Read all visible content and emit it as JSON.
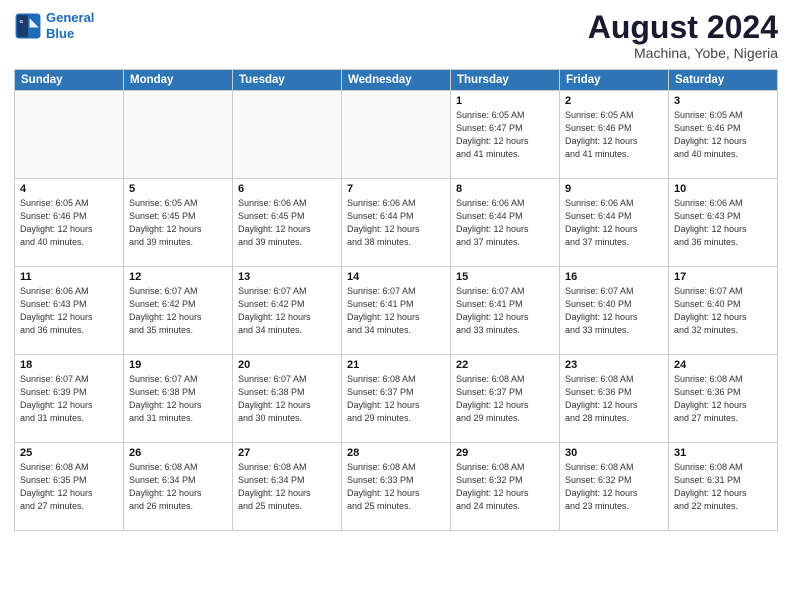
{
  "header": {
    "logo_line1": "General",
    "logo_line2": "Blue",
    "month_year": "August 2024",
    "location": "Machina, Yobe, Nigeria"
  },
  "weekdays": [
    "Sunday",
    "Monday",
    "Tuesday",
    "Wednesday",
    "Thursday",
    "Friday",
    "Saturday"
  ],
  "weeks": [
    [
      {
        "day": "",
        "info": ""
      },
      {
        "day": "",
        "info": ""
      },
      {
        "day": "",
        "info": ""
      },
      {
        "day": "",
        "info": ""
      },
      {
        "day": "1",
        "info": "Sunrise: 6:05 AM\nSunset: 6:47 PM\nDaylight: 12 hours\nand 41 minutes."
      },
      {
        "day": "2",
        "info": "Sunrise: 6:05 AM\nSunset: 6:46 PM\nDaylight: 12 hours\nand 41 minutes."
      },
      {
        "day": "3",
        "info": "Sunrise: 6:05 AM\nSunset: 6:46 PM\nDaylight: 12 hours\nand 40 minutes."
      }
    ],
    [
      {
        "day": "4",
        "info": "Sunrise: 6:05 AM\nSunset: 6:46 PM\nDaylight: 12 hours\nand 40 minutes."
      },
      {
        "day": "5",
        "info": "Sunrise: 6:05 AM\nSunset: 6:45 PM\nDaylight: 12 hours\nand 39 minutes."
      },
      {
        "day": "6",
        "info": "Sunrise: 6:06 AM\nSunset: 6:45 PM\nDaylight: 12 hours\nand 39 minutes."
      },
      {
        "day": "7",
        "info": "Sunrise: 6:06 AM\nSunset: 6:44 PM\nDaylight: 12 hours\nand 38 minutes."
      },
      {
        "day": "8",
        "info": "Sunrise: 6:06 AM\nSunset: 6:44 PM\nDaylight: 12 hours\nand 37 minutes."
      },
      {
        "day": "9",
        "info": "Sunrise: 6:06 AM\nSunset: 6:44 PM\nDaylight: 12 hours\nand 37 minutes."
      },
      {
        "day": "10",
        "info": "Sunrise: 6:06 AM\nSunset: 6:43 PM\nDaylight: 12 hours\nand 36 minutes."
      }
    ],
    [
      {
        "day": "11",
        "info": "Sunrise: 6:06 AM\nSunset: 6:43 PM\nDaylight: 12 hours\nand 36 minutes."
      },
      {
        "day": "12",
        "info": "Sunrise: 6:07 AM\nSunset: 6:42 PM\nDaylight: 12 hours\nand 35 minutes."
      },
      {
        "day": "13",
        "info": "Sunrise: 6:07 AM\nSunset: 6:42 PM\nDaylight: 12 hours\nand 34 minutes."
      },
      {
        "day": "14",
        "info": "Sunrise: 6:07 AM\nSunset: 6:41 PM\nDaylight: 12 hours\nand 34 minutes."
      },
      {
        "day": "15",
        "info": "Sunrise: 6:07 AM\nSunset: 6:41 PM\nDaylight: 12 hours\nand 33 minutes."
      },
      {
        "day": "16",
        "info": "Sunrise: 6:07 AM\nSunset: 6:40 PM\nDaylight: 12 hours\nand 33 minutes."
      },
      {
        "day": "17",
        "info": "Sunrise: 6:07 AM\nSunset: 6:40 PM\nDaylight: 12 hours\nand 32 minutes."
      }
    ],
    [
      {
        "day": "18",
        "info": "Sunrise: 6:07 AM\nSunset: 6:39 PM\nDaylight: 12 hours\nand 31 minutes."
      },
      {
        "day": "19",
        "info": "Sunrise: 6:07 AM\nSunset: 6:38 PM\nDaylight: 12 hours\nand 31 minutes."
      },
      {
        "day": "20",
        "info": "Sunrise: 6:07 AM\nSunset: 6:38 PM\nDaylight: 12 hours\nand 30 minutes."
      },
      {
        "day": "21",
        "info": "Sunrise: 6:08 AM\nSunset: 6:37 PM\nDaylight: 12 hours\nand 29 minutes."
      },
      {
        "day": "22",
        "info": "Sunrise: 6:08 AM\nSunset: 6:37 PM\nDaylight: 12 hours\nand 29 minutes."
      },
      {
        "day": "23",
        "info": "Sunrise: 6:08 AM\nSunset: 6:36 PM\nDaylight: 12 hours\nand 28 minutes."
      },
      {
        "day": "24",
        "info": "Sunrise: 6:08 AM\nSunset: 6:36 PM\nDaylight: 12 hours\nand 27 minutes."
      }
    ],
    [
      {
        "day": "25",
        "info": "Sunrise: 6:08 AM\nSunset: 6:35 PM\nDaylight: 12 hours\nand 27 minutes."
      },
      {
        "day": "26",
        "info": "Sunrise: 6:08 AM\nSunset: 6:34 PM\nDaylight: 12 hours\nand 26 minutes."
      },
      {
        "day": "27",
        "info": "Sunrise: 6:08 AM\nSunset: 6:34 PM\nDaylight: 12 hours\nand 25 minutes."
      },
      {
        "day": "28",
        "info": "Sunrise: 6:08 AM\nSunset: 6:33 PM\nDaylight: 12 hours\nand 25 minutes."
      },
      {
        "day": "29",
        "info": "Sunrise: 6:08 AM\nSunset: 6:32 PM\nDaylight: 12 hours\nand 24 minutes."
      },
      {
        "day": "30",
        "info": "Sunrise: 6:08 AM\nSunset: 6:32 PM\nDaylight: 12 hours\nand 23 minutes."
      },
      {
        "day": "31",
        "info": "Sunrise: 6:08 AM\nSunset: 6:31 PM\nDaylight: 12 hours\nand 22 minutes."
      }
    ]
  ]
}
